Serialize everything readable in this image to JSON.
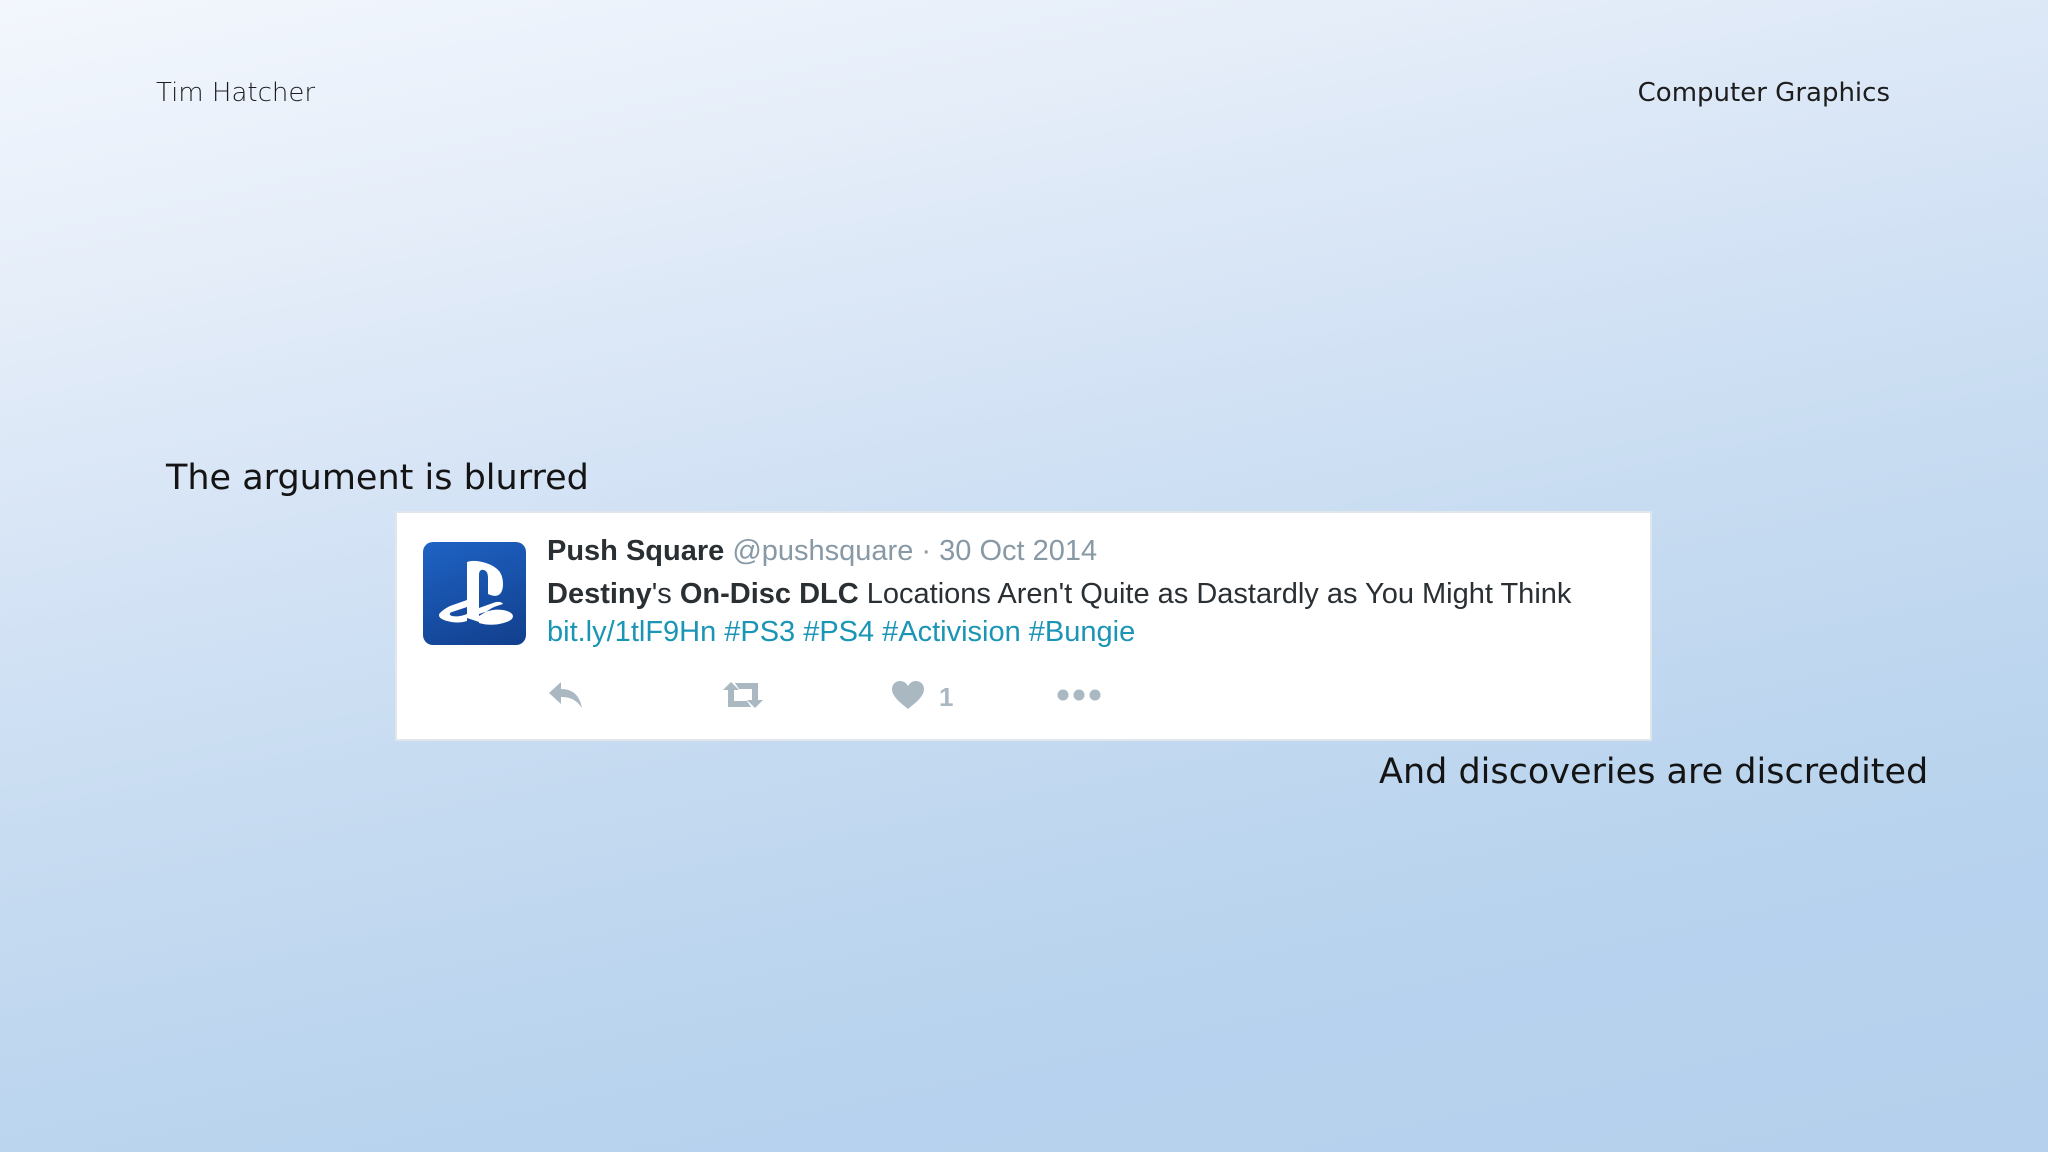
{
  "slide": {
    "author": "Tim Hatcher",
    "course": "Computer Graphics",
    "caption_top": "The argument is blurred",
    "caption_bottom": "And discoveries are discredited"
  },
  "tweet": {
    "display_name": "Push Square",
    "handle": "@pushsquare",
    "separator": "·",
    "date": "30 Oct 2014",
    "text_bold_1": "Destiny",
    "text_plain_1": "'s ",
    "text_bold_2": "On-Disc DLC",
    "text_plain_2": " Locations Aren't Quite as Dastardly as You Might Think",
    "link": "bit.ly/1tlF9Hn",
    "hashtags": [
      "#PS3",
      "#PS4",
      "#Activision",
      "#Bungie"
    ],
    "like_count": "1",
    "avatar_icon": "playstation-logo-icon",
    "colors": {
      "name": "#292f33",
      "muted": "#8899a6",
      "link": "#1b95b6",
      "avatar_bg": "#174fa6",
      "action": "#aab8c2"
    }
  }
}
